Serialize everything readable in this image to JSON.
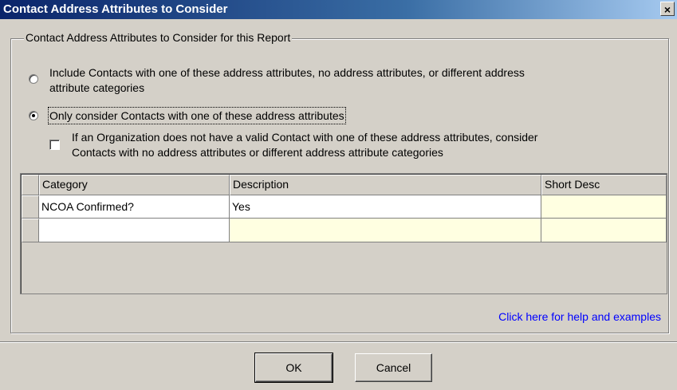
{
  "window": {
    "title": "Contact Address Attributes to Consider",
    "close_glyph": "×"
  },
  "group": {
    "label": "Contact Address Attributes to Consider for this Report"
  },
  "options": {
    "include_all_line1": "Include Contacts with one of these address attributes, no address attributes, or different address",
    "include_all_line2": "attribute categories",
    "only_these": "Only consider Contacts with one of these address attributes",
    "fallback_line1": "If an Organization does not have a valid Contact with one of these address attributes, consider",
    "fallback_line2": "Contacts with no address attributes or different address attribute categories",
    "selected": "only_these",
    "fallback_checked": false
  },
  "grid": {
    "columns": [
      "Category",
      "Description",
      "Short Desc"
    ],
    "rows": [
      [
        "NCOA Confirmed?",
        "Yes",
        ""
      ],
      [
        "",
        "",
        ""
      ]
    ]
  },
  "help_link": "Click here for help and examples",
  "buttons": {
    "ok": "OK",
    "cancel": "Cancel"
  },
  "colors": {
    "window_bg": "#d4d0c8",
    "titlebar_start": "#0a246a",
    "link": "#0000ff",
    "readonly_cell": "#ffffe1"
  }
}
